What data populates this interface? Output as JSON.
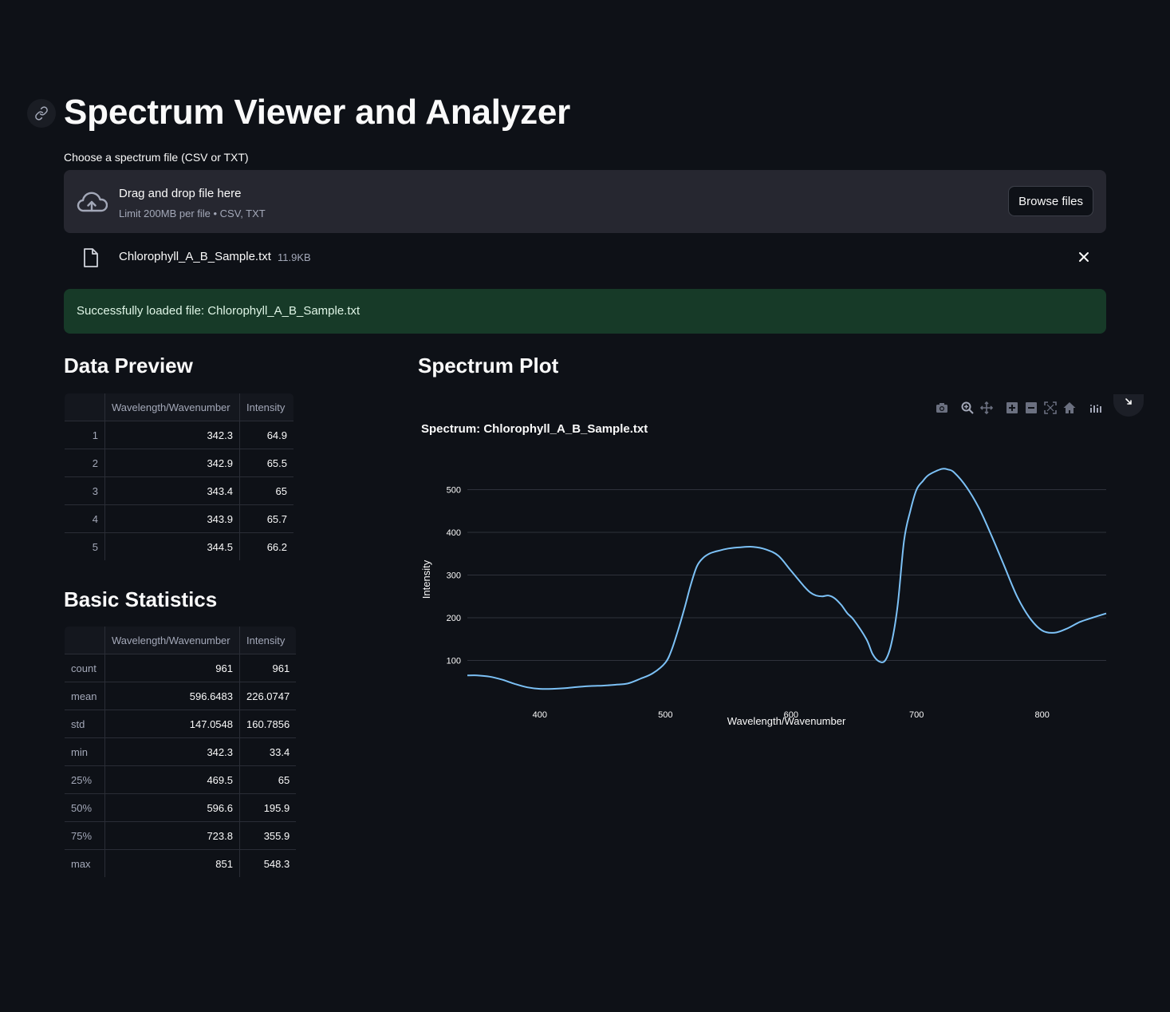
{
  "page": {
    "title": "Spectrum Viewer and Analyzer"
  },
  "uploader": {
    "label": "Choose a spectrum file (CSV or TXT)",
    "drop_title": "Drag and drop file here",
    "drop_sub": "Limit 200MB per file • CSV, TXT",
    "browse_label": "Browse files",
    "file_name": "Chlorophyll_A_B_Sample.txt",
    "file_size": "11.9KB"
  },
  "alert": {
    "text": "Successfully loaded file: Chlorophyll_A_B_Sample.txt",
    "color": "#173a28"
  },
  "preview": {
    "heading": "Data Preview",
    "columns": [
      "",
      "Wavelength/Wavenumber",
      "Intensity"
    ],
    "rows": [
      [
        "1",
        "342.3",
        "64.9"
      ],
      [
        "2",
        "342.9",
        "65.5"
      ],
      [
        "3",
        "343.4",
        "65"
      ],
      [
        "4",
        "343.9",
        "65.7"
      ],
      [
        "5",
        "344.5",
        "66.2"
      ]
    ]
  },
  "stats": {
    "heading": "Basic Statistics",
    "columns": [
      "",
      "Wavelength/Wavenumber",
      "Intensity"
    ],
    "rows": [
      [
        "count",
        "961",
        "961"
      ],
      [
        "mean",
        "596.6483",
        "226.0747"
      ],
      [
        "std",
        "147.0548",
        "160.7856"
      ],
      [
        "min",
        "342.3",
        "33.4"
      ],
      [
        "25%",
        "469.5",
        "65"
      ],
      [
        "50%",
        "596.6",
        "195.9"
      ],
      [
        "75%",
        "723.8",
        "355.9"
      ],
      [
        "max",
        "851",
        "548.3"
      ]
    ]
  },
  "plot": {
    "heading": "Spectrum Plot",
    "modebar": [
      "camera-icon",
      "zoom-icon",
      "pan-icon",
      "zoom-in-icon",
      "zoom-out-icon",
      "autoscale-icon",
      "reset-axes-icon",
      "plotly-logo-icon"
    ]
  },
  "chart_data": {
    "type": "line",
    "title": "Spectrum: Chlorophyll_A_B_Sample.txt",
    "xlabel": "Wavelength/Wavenumber",
    "ylabel": "Intensity",
    "xlim": [
      342.3,
      851
    ],
    "ylim": [
      0,
      570
    ],
    "xticks": [
      400,
      500,
      600,
      700,
      800
    ],
    "yticks": [
      100,
      200,
      300,
      400,
      500
    ],
    "grid": "horizontal",
    "line_color": "#7cc1f6",
    "series": [
      {
        "x": [
          342.3,
          350,
          360,
          370,
          380,
          390,
          400,
          410,
          420,
          430,
          440,
          450,
          460,
          470,
          480,
          490,
          500,
          505,
          510,
          515,
          520,
          525,
          530,
          535,
          540,
          550,
          560,
          570,
          580,
          590,
          600,
          610,
          615,
          620,
          625,
          630,
          635,
          640,
          645,
          650,
          660,
          665,
          670,
          675,
          680,
          685,
          690,
          695,
          700,
          705,
          710,
          720,
          725,
          730,
          740,
          750,
          760,
          770,
          780,
          790,
          800,
          810,
          820,
          830,
          840,
          851
        ],
        "y": [
          64.9,
          65,
          62,
          55,
          45,
          37,
          33.5,
          33.4,
          35,
          38,
          40,
          41,
          43,
          46,
          57,
          70,
          95,
          125,
          170,
          220,
          275,
          320,
          340,
          350,
          355,
          362,
          365,
          366,
          360,
          345,
          310,
          275,
          260,
          252,
          250,
          252,
          245,
          230,
          210,
          195,
          150,
          115,
          98,
          100,
          140,
          230,
          380,
          450,
          500,
          520,
          535,
          548.3,
          547,
          540,
          505,
          455,
          390,
          320,
          250,
          200,
          170,
          165,
          175,
          190,
          200,
          210
        ]
      }
    ]
  }
}
